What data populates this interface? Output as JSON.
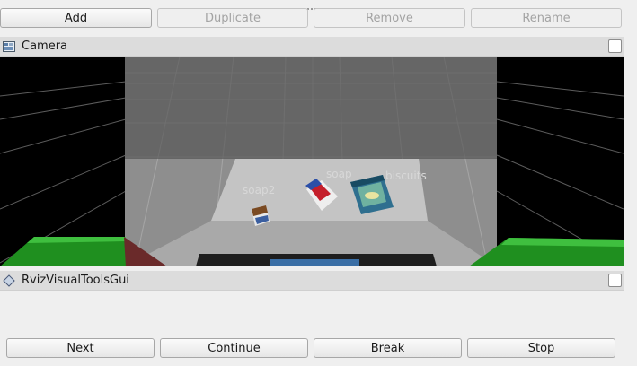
{
  "toolbar": {
    "add_label": "Add",
    "duplicate_label": "Duplicate",
    "remove_label": "Remove",
    "rename_label": "Rename"
  },
  "camera_panel": {
    "title": "Camera",
    "icon": "camera-panel-icon",
    "objects": {
      "soap2": "soap2",
      "soap": "soap",
      "biscuits": "biscuits"
    }
  },
  "rviz_panel": {
    "title": "RvizVisualToolsGui",
    "icon": "diamond-panel-icon"
  },
  "controls": {
    "next_label": "Next",
    "continue_label": "Continue",
    "break_label": "Break",
    "stop_label": "Stop"
  },
  "colors": {
    "window_bg": "#efefef",
    "header_bg": "#dcdcdc",
    "floor": "#8a8a8a",
    "table": "#c5c5c5",
    "gripper_green": "#1f8f1f"
  }
}
